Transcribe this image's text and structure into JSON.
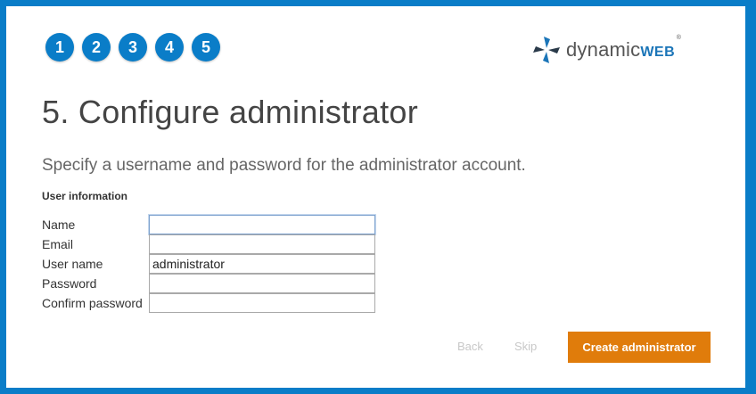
{
  "steps": [
    "1",
    "2",
    "3",
    "4",
    "5"
  ],
  "logo": {
    "text_main": "dynamic",
    "text_accent": "WEB",
    "registered": "®",
    "icon": "dynamicweb-pinwheel-icon"
  },
  "page": {
    "title": "5. Configure administrator",
    "subtitle": "Specify a username and password for the administrator account.",
    "section_title": "User information"
  },
  "form": {
    "name": {
      "label": "Name",
      "value": ""
    },
    "email": {
      "label": "Email",
      "value": ""
    },
    "username": {
      "label": "User name",
      "value": "administrator"
    },
    "password": {
      "label": "Password",
      "value": ""
    },
    "confirm_password": {
      "label": "Confirm password",
      "value": ""
    }
  },
  "buttons": {
    "back": "Back",
    "skip": "Skip",
    "create": "Create administrator"
  },
  "colors": {
    "frame": "#0a7dc8",
    "step": "#0a7dc8",
    "primary_button": "#e07c0b",
    "logo_accent": "#1b75b8"
  }
}
